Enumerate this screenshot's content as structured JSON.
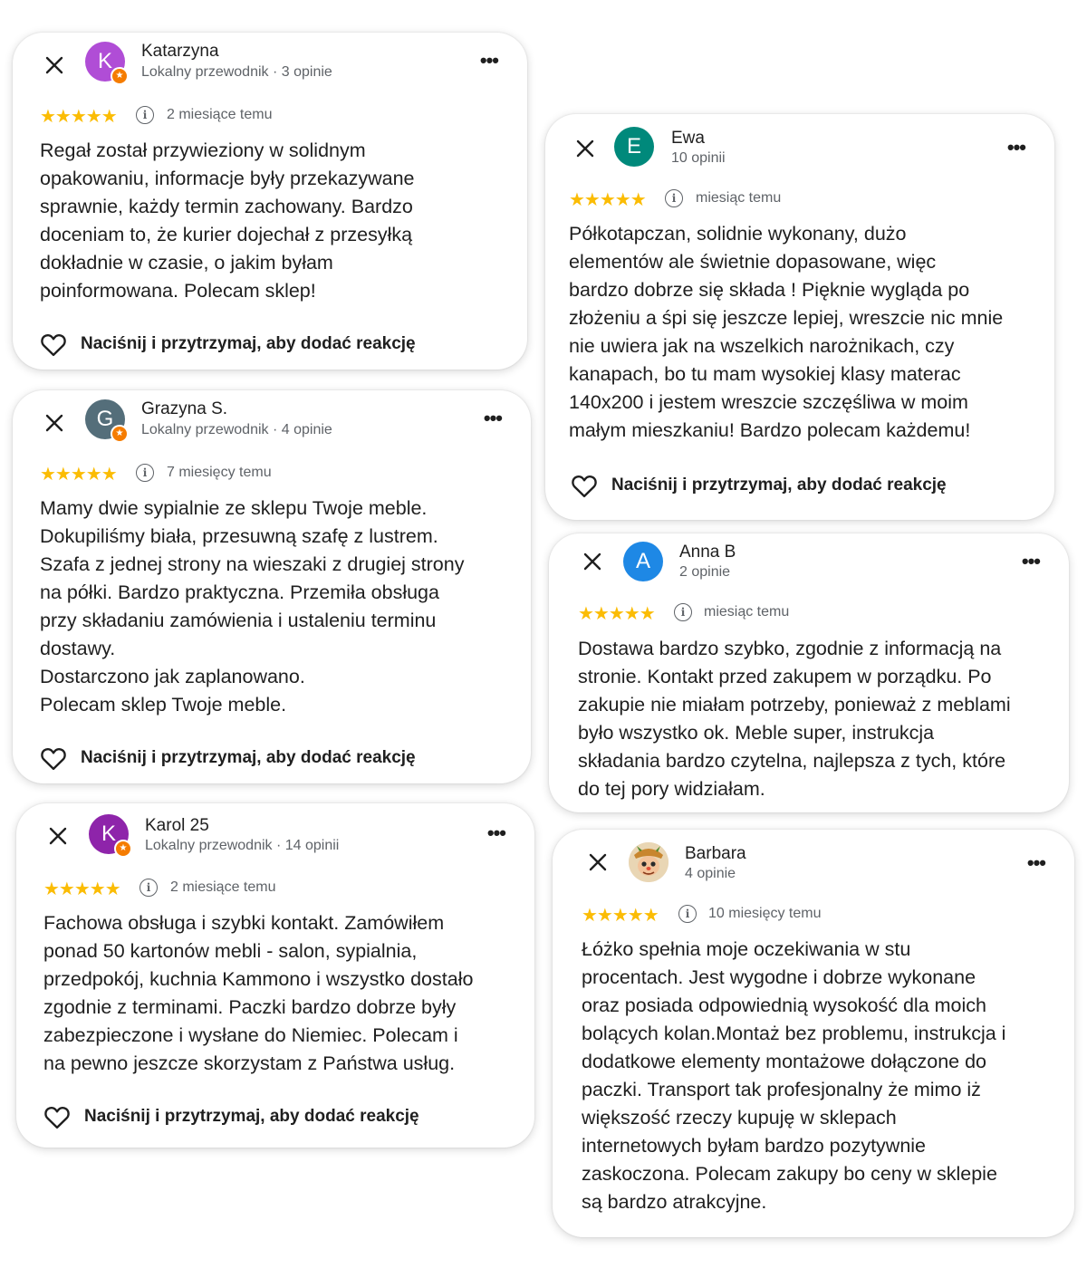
{
  "reaction_label": "Naciśnij i przytrzymaj, aby dodać reakcję",
  "more_label": "•••",
  "stars": "★★★★★",
  "info_glyph": "i",
  "colors": {
    "star": "#fbbc04",
    "local_guide_badge": "#f57c00"
  },
  "reviews": [
    {
      "name": "Katarzyna",
      "initial": "K",
      "avatar_color": "#b04dd6",
      "local_guide": true,
      "subtitle": "Lokalny przewodnik · 3 opinie",
      "date": "2 miesiące temu",
      "text": "Regał został przywieziony w solidnym\nopakowaniu, informacje były przekazywane\nsprawnie, każdy termin zachowany. Bardzo\ndoceniam to, że kurier dojechał z przesyłką\ndokładnie w czasie, o jakim byłam\npoinformowana. Polecam sklep!"
    },
    {
      "name": "Grazyna S.",
      "initial": "G",
      "avatar_color": "#546e7a",
      "local_guide": true,
      "subtitle": "Lokalny przewodnik · 4 opinie",
      "date": "7 miesięcy temu",
      "text": "Mamy dwie sypialnie ze sklepu Twoje meble.\nDokupiliśmy biała, przesuwną szafę z lustrem.\nSzafa z jednej strony na wieszaki z drugiej strony\nna półki. Bardzo praktyczna. Przemiła obsługa\nprzy składaniu zamówienia i ustaleniu terminu\ndostawy.\nDostarczono jak zaplanowano.\nPolecam sklep Twoje meble."
    },
    {
      "name": "Karol 25",
      "initial": "K",
      "avatar_color": "#8e24aa",
      "local_guide": true,
      "subtitle": "Lokalny przewodnik · 14 opinii",
      "date": "2 miesiące temu",
      "text": "Fachowa obsługa i szybki kontakt. Zamówiłem\nponad 50 kartonów mebli - salon, sypialnia,\nprzedpokój, kuchnia Kammono i wszystko dostało\nzgodnie z terminami. Paczki bardzo dobrze były\nzabezpieczone i wysłane do Niemiec. Polecam i\nna pewno jeszcze skorzystam z Państwa usług."
    },
    {
      "name": "Ewa",
      "initial": "E",
      "avatar_color": "#00897b",
      "local_guide": false,
      "subtitle": "10 opinii",
      "date": "miesiąc temu",
      "text": "Półkotapczan, solidnie wykonany, dużo\nelementów ale świetnie dopasowane,  więc\nbardzo dobrze się składa ! Pięknie wygląda po\nzłożeniu a śpi się jeszcze lepiej, wreszcie nic mnie\nnie uwiera jak na wszelkich narożnikach, czy\nkanapach,  bo tu mam wysokiej klasy materac\n140x200 i jestem wreszcie szczęśliwa w  moim\nmałym mieszkaniu! Bardzo polecam każdemu!"
    },
    {
      "name": "Anna B",
      "initial": "A",
      "avatar_color": "#1e88e5",
      "local_guide": false,
      "subtitle": "2 opinie",
      "date": "miesiąc temu",
      "text": "Dostawa bardzo szybko, zgodnie z informacją na\nstronie. Kontakt przed zakupem w porządku. Po\nzakupie nie miałam potrzeby, ponieważ z meblami\nbyło wszystko ok. Meble super, instrukcja\nskładania bardzo czytelna, najlepsza z tych, które\ndo tej pory widziałam."
    },
    {
      "name": "Barbara",
      "initial": "",
      "avatar_color": "#e0c49a",
      "local_guide": false,
      "subtitle": "4 opinie",
      "date": "10 miesięcy temu",
      "text": "Łóżko spełnia moje oczekiwania w stu\nprocentach. Jest wygodne i dobrze wykonane\noraz posiada odpowiednią wysokość dla moich\nbolących kolan.Montaż bez problemu, instrukcja i\ndodatkowe elementy montażowe dołączone do\npaczki. Transport tak profesjonalny że mimo iż\nwiększość rzeczy kupuję w sklepach\ninternetowych byłam bardzo pozytywnie\nzaskoczona. Polecam zakupy bo ceny w sklepie\nsą bardzo atrakcyjne."
    }
  ]
}
